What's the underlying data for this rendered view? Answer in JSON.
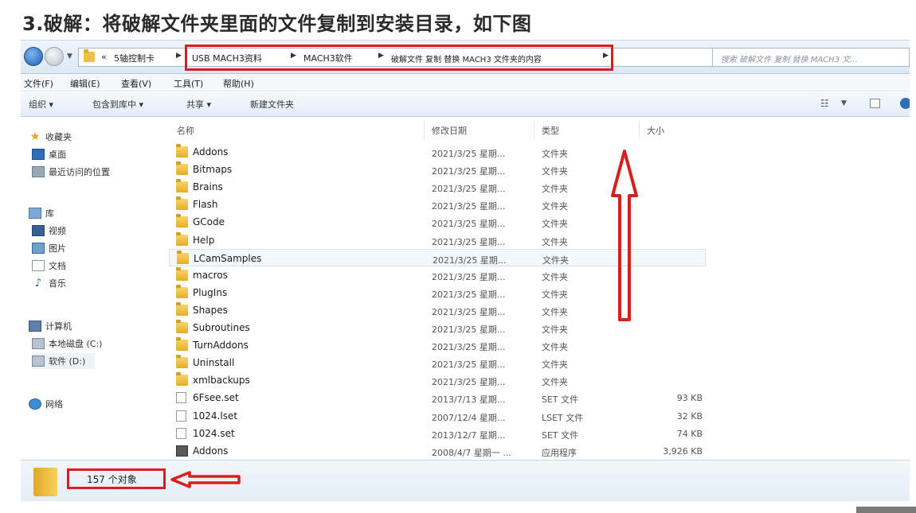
{
  "heading": "3.破解：将破解文件夹里面的文件复制到安装目录，如下图",
  "address": {
    "overflow": "«",
    "crumbs": [
      "5轴控制卡",
      "USB MACH3资料",
      "MACH3软件",
      "破解文件 复制 替换 MACH3 文件夹的内容"
    ],
    "search_placeholder": "搜索 破解文件 复制 替换 MACH3 文..."
  },
  "menu": [
    "文件(F)",
    "编辑(E)",
    "查看(V)",
    "工具(T)",
    "帮助(H)"
  ],
  "toolbar": {
    "organize": "组织 ▾",
    "include": "包含到库中 ▾",
    "share": "共享 ▾",
    "new_folder": "新建文件夹"
  },
  "nav": {
    "favorites": "收藏夹",
    "desktop": "桌面",
    "recent": "最近访问的位置",
    "libraries": "库",
    "videos": "视频",
    "pictures": "图片",
    "documents": "文档",
    "music": "音乐",
    "computer": "计算机",
    "disk_c": "本地磁盘 (C:)",
    "disk_d": "软件 (D:)",
    "network": "网络"
  },
  "columns": {
    "name": "名称",
    "date": "修改日期",
    "type": "类型",
    "size": "大小"
  },
  "rows": [
    {
      "name": "Addons",
      "date": "2021/3/25 星期...",
      "type": "文件夹",
      "size": "",
      "kind": "folder"
    },
    {
      "name": "Bitmaps",
      "date": "2021/3/25 星期...",
      "type": "文件夹",
      "size": "",
      "kind": "folder"
    },
    {
      "name": "Brains",
      "date": "2021/3/25 星期...",
      "type": "文件夹",
      "size": "",
      "kind": "folder"
    },
    {
      "name": "Flash",
      "date": "2021/3/25 星期...",
      "type": "文件夹",
      "size": "",
      "kind": "folder"
    },
    {
      "name": "GCode",
      "date": "2021/3/25 星期...",
      "type": "文件夹",
      "size": "",
      "kind": "folder"
    },
    {
      "name": "Help",
      "date": "2021/3/25 星期...",
      "type": "文件夹",
      "size": "",
      "kind": "folder"
    },
    {
      "name": "LCamSamples",
      "date": "2021/3/25 星期...",
      "type": "文件夹",
      "size": "",
      "kind": "folder"
    },
    {
      "name": "macros",
      "date": "2021/3/25 星期...",
      "type": "文件夹",
      "size": "",
      "kind": "folder"
    },
    {
      "name": "PlugIns",
      "date": "2021/3/25 星期...",
      "type": "文件夹",
      "size": "",
      "kind": "folder"
    },
    {
      "name": "Shapes",
      "date": "2021/3/25 星期...",
      "type": "文件夹",
      "size": "",
      "kind": "folder"
    },
    {
      "name": "Subroutines",
      "date": "2021/3/25 星期...",
      "type": "文件夹",
      "size": "",
      "kind": "folder"
    },
    {
      "name": "TurnAddons",
      "date": "2021/3/25 星期...",
      "type": "文件夹",
      "size": "",
      "kind": "folder"
    },
    {
      "name": "Uninstall",
      "date": "2021/3/25 星期...",
      "type": "文件夹",
      "size": "",
      "kind": "folder"
    },
    {
      "name": "xmlbackups",
      "date": "2021/3/25 星期...",
      "type": "文件夹",
      "size": "",
      "kind": "folder"
    },
    {
      "name": "6Fsee.set",
      "date": "2013/7/13 星期...",
      "type": "SET 文件",
      "size": "93 KB",
      "kind": "file"
    },
    {
      "name": "1024.lset",
      "date": "2007/12/4 星期...",
      "type": "LSET 文件",
      "size": "32 KB",
      "kind": "file"
    },
    {
      "name": "1024.set",
      "date": "2013/12/7 星期...",
      "type": "SET 文件",
      "size": "74 KB",
      "kind": "file"
    },
    {
      "name": "Addons",
      "date": "2008/4/7 星期一 ...",
      "type": "应用程序",
      "size": "3,926 KB",
      "kind": "app"
    }
  ],
  "status": "157 个对象",
  "colors": {
    "annotation": "#d62020",
    "folder": "#f0c040"
  }
}
